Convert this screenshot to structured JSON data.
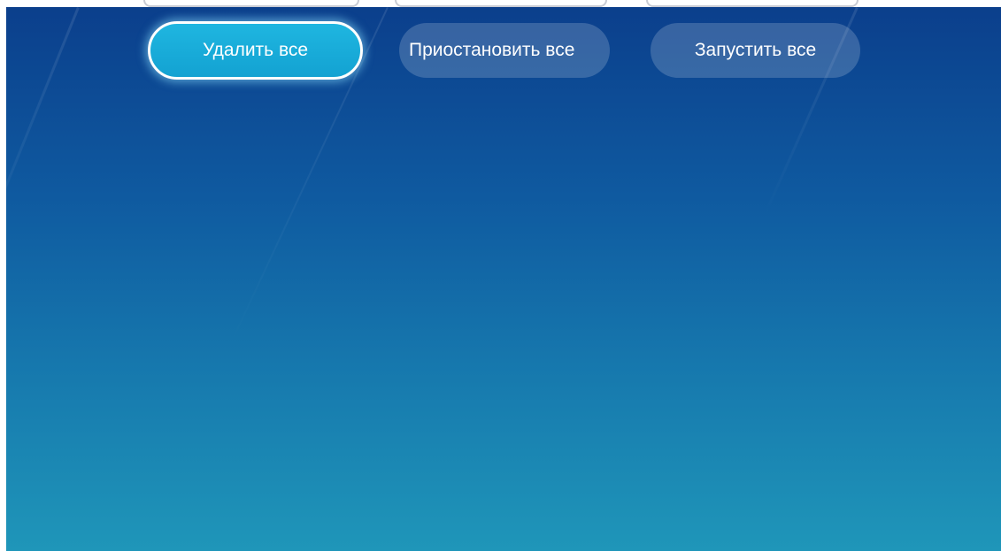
{
  "toolbar": {
    "delete_all_label": "Удалить все",
    "pause_all_label": "Приостановить все",
    "start_all_label": "Запустить все"
  },
  "colors": {
    "background_top": "#0b3f8c",
    "background_bottom": "#1f96b9",
    "focused_button": "#1fb6e0",
    "button_idle": "rgba(255,255,255,0.18)"
  }
}
